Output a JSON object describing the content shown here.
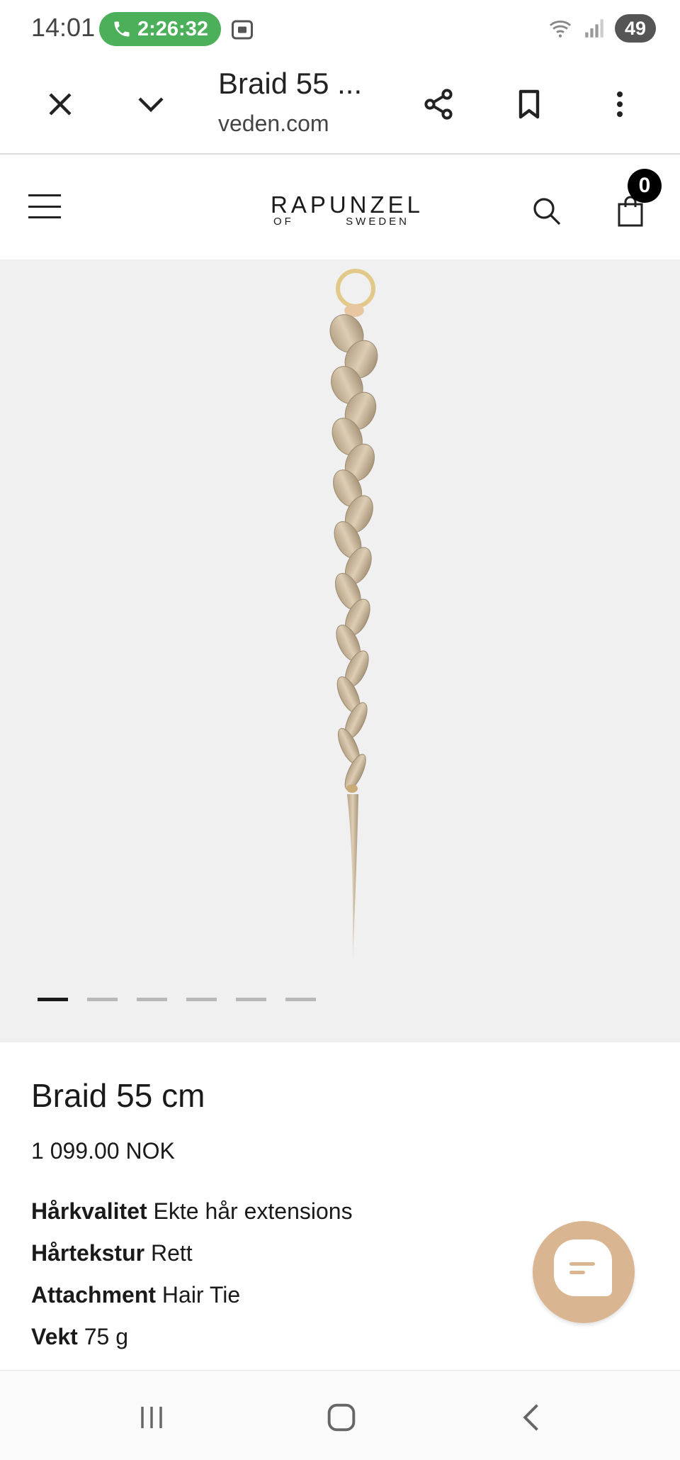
{
  "status_bar": {
    "time": "14:01",
    "call_timer": "2:26:32",
    "battery": "49"
  },
  "browser": {
    "title": "Braid 55 ...",
    "url": "veden.com"
  },
  "site": {
    "logo_main": "RAPUNZEL",
    "logo_sub_left": "OF",
    "logo_sub_right": "SWEDEN",
    "cart_count": "0"
  },
  "gallery": {
    "slide_count": 6,
    "active_slide": 1
  },
  "product": {
    "name": "Braid 55 cm",
    "price": "1 099.00 NOK",
    "attributes": [
      {
        "label": "Hårkvalitet",
        "value": "Ekte hår extensions"
      },
      {
        "label": "Hårtekstur",
        "value": "Rett"
      },
      {
        "label": "Attachment",
        "value": "Hair Tie"
      },
      {
        "label": "Vekt",
        "value": "75 g"
      }
    ]
  },
  "colors": {
    "call_green": "#4cb05a",
    "gallery_bg": "#f0f0f0",
    "chat_accent": "#d9b592"
  },
  "icons": {
    "close": "close-icon",
    "collapse": "chevron-down-icon",
    "share": "share-icon",
    "bookmark": "bookmark-icon",
    "more": "more-vert-icon",
    "menu": "hamburger-icon",
    "search": "search-icon",
    "cart": "shopping-bag-icon",
    "chat": "chat-icon"
  }
}
